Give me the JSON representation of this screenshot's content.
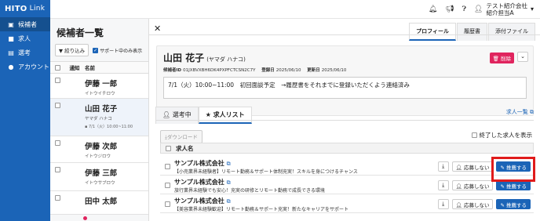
{
  "app": {
    "logo_main": "HITO",
    "logo_sub": "Link"
  },
  "sidebar": {
    "items": [
      {
        "label": "候補者",
        "icon": "person-card-icon"
      },
      {
        "label": "求人",
        "icon": "briefcase-icon"
      },
      {
        "label": "選考",
        "icon": "clipboard-icon"
      },
      {
        "label": "アカウント",
        "icon": "user-icon"
      }
    ]
  },
  "topbar": {
    "company": "テスト紹介会社",
    "user": "紹介担当A"
  },
  "list": {
    "title": "候補者一覧",
    "filter_label": "絞り込み",
    "support_label": "サポート中のみ表示",
    "col_notice": "通知",
    "col_name": "名前",
    "rows": [
      {
        "name": "伊藤 一郎",
        "kana": "イトウイチロウ",
        "memo": ""
      },
      {
        "name": "山田 花子",
        "kana": "ヤマダ ハナコ",
        "memo": "7/1（火）10:00~11:00"
      },
      {
        "name": "伊藤 次郎",
        "kana": "イトウジロウ",
        "memo": ""
      },
      {
        "name": "伊藤 三郎",
        "kana": "イトウサブロウ",
        "memo": ""
      },
      {
        "name": "田中 太郎",
        "kana": "",
        "memo": ""
      }
    ]
  },
  "detail": {
    "tabs": [
      "プロフィール",
      "履歴書",
      "添付ファイル"
    ],
    "name": "山田 花子",
    "kana": "(ヤマダ ハナコ)",
    "id_label": "候補者ID",
    "id": "01JXBVXBH6DK4PXPFCTCSN2C7Y",
    "registered_label": "登録日",
    "registered": "2025/06/10",
    "updated_label": "更新日",
    "updated": "2025/06/10",
    "memo": "7/1（火）10:00~11:00　初回面談予定　→履歴書をそれまでに登録いただくよう連絡済み",
    "delete_label": "削除",
    "subtabs": [
      "選考中",
      "求人リスト"
    ],
    "joblist_link": "求人一覧",
    "download_label": "ダウンロード",
    "closed_label": "終了した求人を表示",
    "job_col": "求人名",
    "decline_label": "応募しない",
    "recommend_label": "推薦する",
    "jobs": [
      {
        "company": "サンプル株式会社",
        "desc": "【小売業界未経験者】リモート勤務＆サポート体制充実！スキルを身につけるチャンス"
      },
      {
        "company": "サンプル株式会社",
        "desc": "旅行業界未経験でも安心！充実の研修とリモート勤務で成長できる環境"
      },
      {
        "company": "サンプル株式会社",
        "desc": "【美容業界未経験歓迎】リモート勤務＆サポート充実！新たなキャリアをサポート"
      }
    ]
  }
}
